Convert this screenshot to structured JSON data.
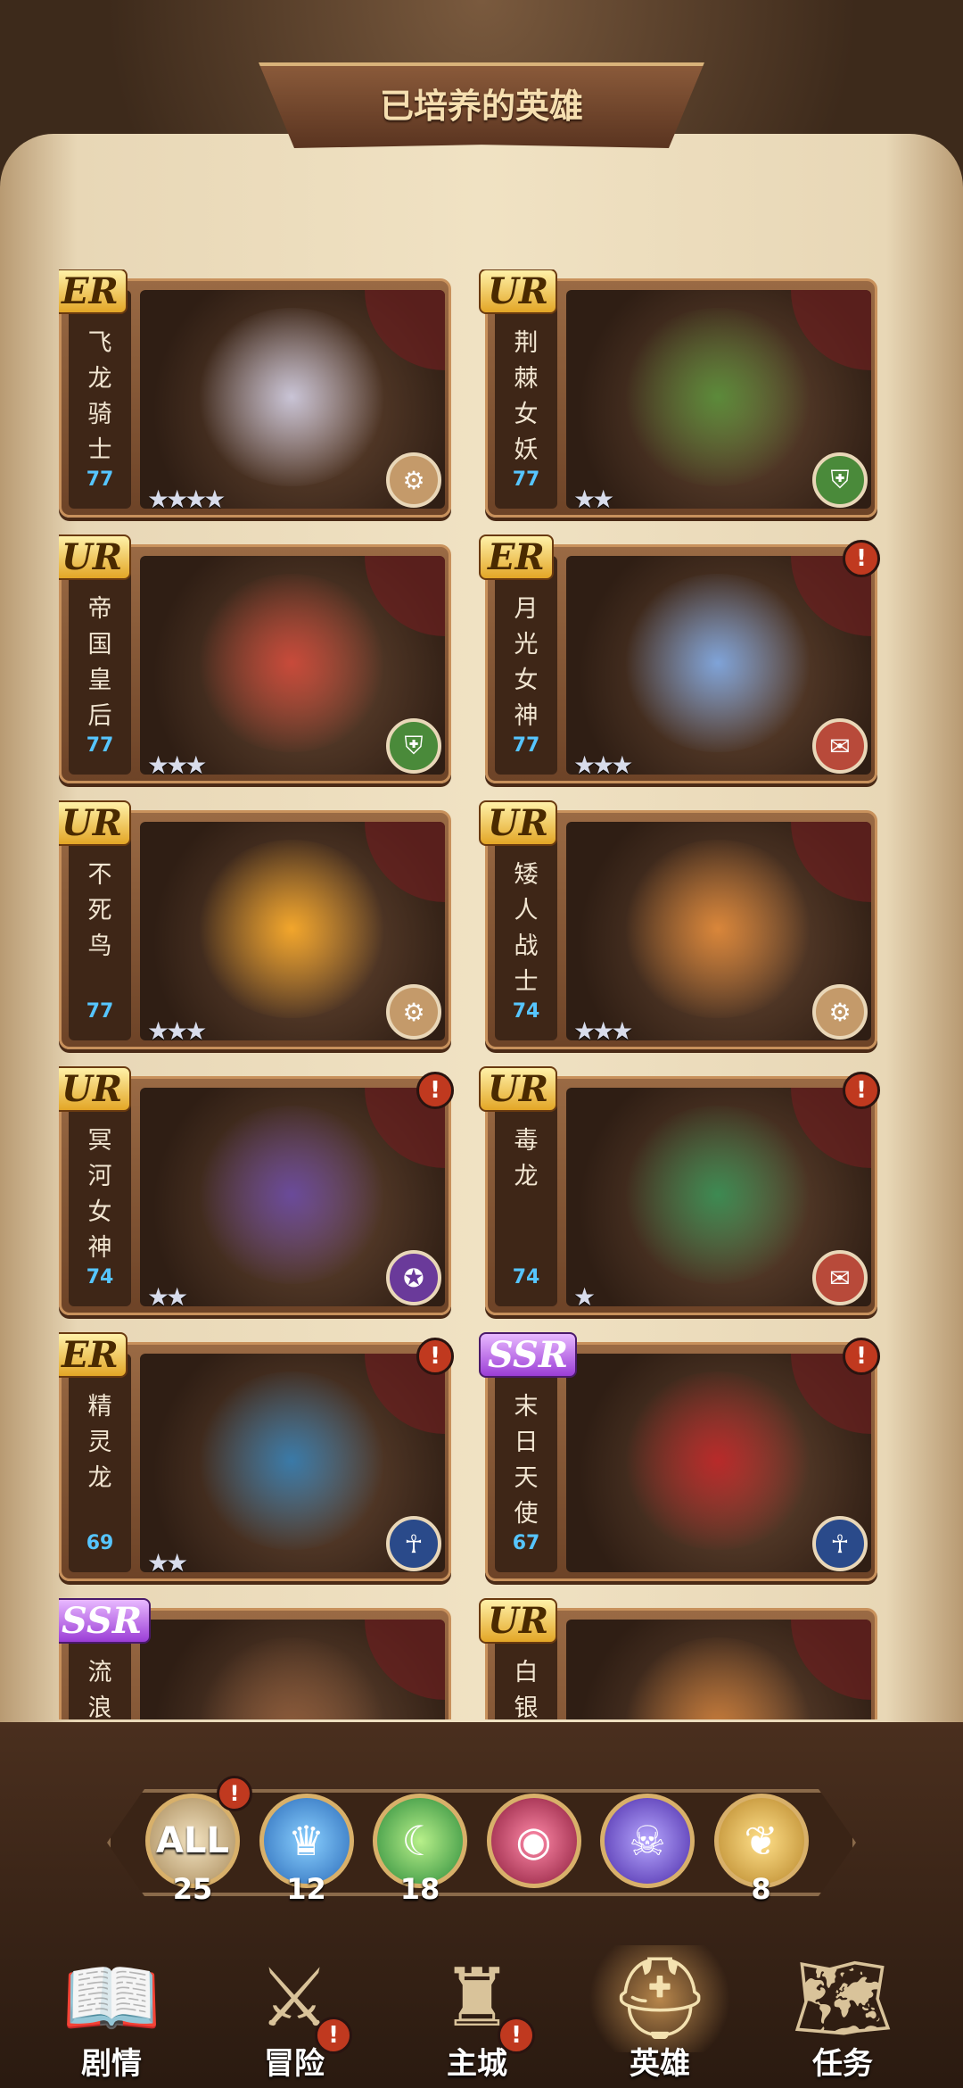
{
  "header": {
    "title": "已培养的英雄"
  },
  "heroes": [
    {
      "rarity": "ER",
      "name": [
        "飞",
        "龙",
        "骑",
        "士"
      ],
      "level": "77",
      "stars": "★★★★",
      "class_icon": "cannon-icon",
      "alert": false
    },
    {
      "rarity": "UR",
      "name": [
        "荆",
        "棘",
        "女",
        "妖"
      ],
      "level": "77",
      "stars": "★★",
      "class_icon": "knight-icon",
      "alert": false
    },
    {
      "rarity": "UR",
      "name": [
        "帝",
        "国",
        "皇",
        "后"
      ],
      "level": "77",
      "stars": "★★★",
      "class_icon": "knight-icon",
      "alert": false
    },
    {
      "rarity": "ER",
      "name": [
        "月",
        "光",
        "女",
        "神"
      ],
      "level": "77",
      "stars": "★★★",
      "class_icon": "scroll-icon",
      "alert": true
    },
    {
      "rarity": "UR",
      "name": [
        "不",
        "死",
        "鸟"
      ],
      "level": "77",
      "stars": "★★★",
      "class_icon": "cannon-icon",
      "alert": false
    },
    {
      "rarity": "UR",
      "name": [
        "矮",
        "人",
        "战",
        "士"
      ],
      "level": "74",
      "stars": "★★★",
      "class_icon": "cannon-icon",
      "alert": false
    },
    {
      "rarity": "UR",
      "name": [
        "冥",
        "河",
        "女",
        "神"
      ],
      "level": "74",
      "stars": "★★",
      "class_icon": "mage-icon",
      "alert": true
    },
    {
      "rarity": "UR",
      "name": [
        "毒",
        "龙"
      ],
      "level": "74",
      "stars": "★",
      "class_icon": "scroll-icon",
      "alert": true
    },
    {
      "rarity": "ER",
      "name": [
        "精",
        "灵",
        "龙"
      ],
      "level": "69",
      "stars": "★★",
      "class_icon": "priest-icon",
      "alert": true
    },
    {
      "rarity": "SSR",
      "name": [
        "末",
        "日",
        "天",
        "使"
      ],
      "level": "67",
      "stars": "",
      "class_icon": "priest-icon",
      "alert": true
    },
    {
      "rarity": "SSR",
      "name": [
        "流",
        "浪"
      ],
      "level": "",
      "stars": "",
      "class_icon": "",
      "alert": false
    },
    {
      "rarity": "UR",
      "name": [
        "白",
        "银"
      ],
      "level": "",
      "stars": "",
      "class_icon": "",
      "alert": false
    }
  ],
  "filters": [
    {
      "label": "ALL",
      "count": "25",
      "icon": "all-icon",
      "alert": true
    },
    {
      "label": "",
      "count": "12",
      "icon": "crown-icon",
      "alert": false
    },
    {
      "label": "",
      "count": "18",
      "icon": "moon-icon",
      "alert": false
    },
    {
      "label": "",
      "count": "",
      "icon": "eye-icon",
      "alert": false
    },
    {
      "label": "",
      "count": "",
      "icon": "ghost-icon",
      "alert": false
    },
    {
      "label": "",
      "count": "8",
      "icon": "wings-icon",
      "alert": false
    }
  ],
  "nav": [
    {
      "label": "剧情",
      "icon": "book-icon",
      "alert": false,
      "active": false
    },
    {
      "label": "冒险",
      "icon": "swords-icon",
      "alert": true,
      "active": false
    },
    {
      "label": "主城",
      "icon": "castle-icon",
      "alert": true,
      "active": false
    },
    {
      "label": "英雄",
      "icon": "helmet-icon",
      "alert": false,
      "active": true
    },
    {
      "label": "任务",
      "icon": "map-icon",
      "alert": false,
      "active": false
    }
  ],
  "colors": {
    "level": "#56c5ff",
    "alert": "#c0391f",
    "gold": "#d8b06a"
  }
}
